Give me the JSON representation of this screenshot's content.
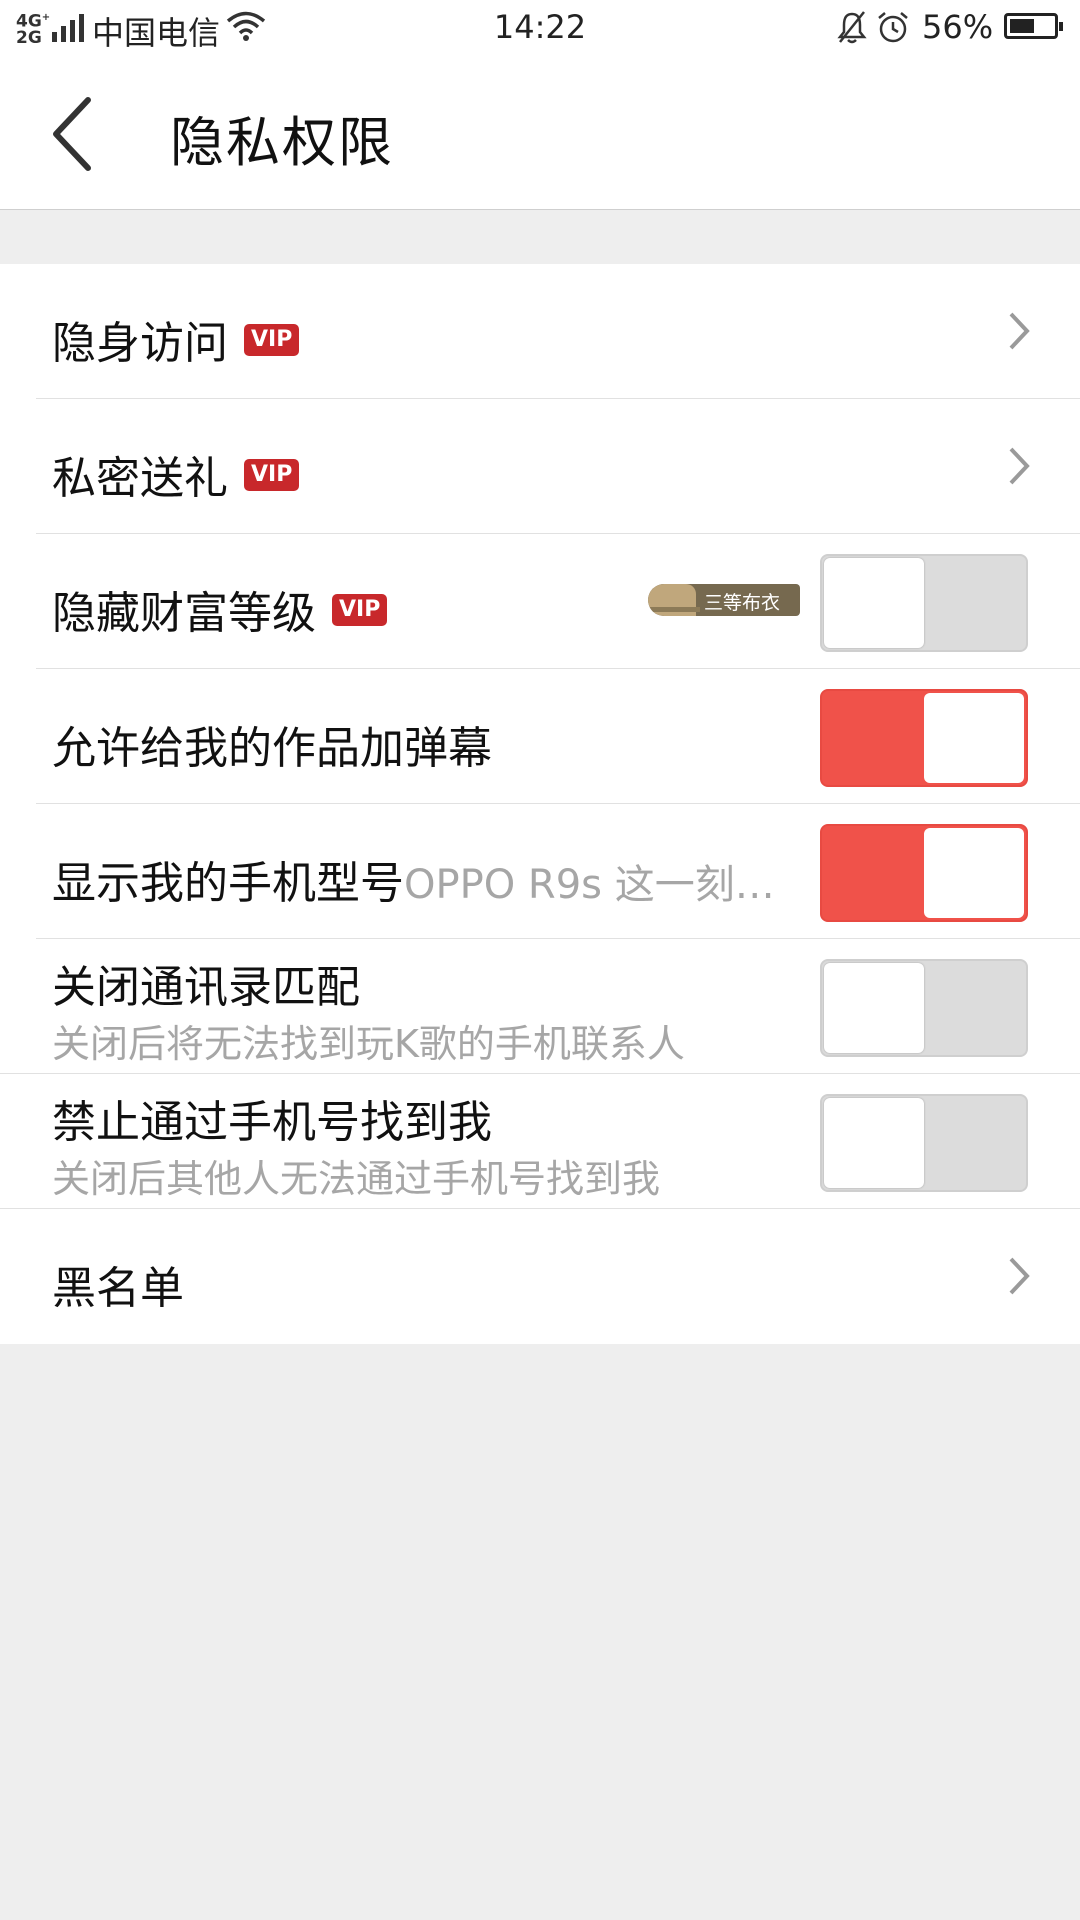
{
  "status_bar": {
    "network": "4G+ 2G",
    "carrier": "中国电信",
    "time": "14:22",
    "battery_percent": "56%",
    "battery_level": 0.56
  },
  "nav": {
    "title": "隐私权限",
    "back_icon": "chevron-left-icon"
  },
  "colors": {
    "accent": "#f0524a",
    "vip": "#c8282b",
    "toggle_off": "#dcdcdc"
  },
  "rows": [
    {
      "title": "隐身访问",
      "vip": "VIP",
      "control": "chevron"
    },
    {
      "title": "私密送礼",
      "vip": "VIP",
      "control": "chevron"
    },
    {
      "title": "隐藏财富等级",
      "vip": "VIP",
      "badge": "三等布衣",
      "control": "toggle",
      "on": false
    },
    {
      "title": "允许给我的作品加弹幕",
      "control": "toggle",
      "on": true
    },
    {
      "title": "显示我的手机型号",
      "extra": "OPPO R9s 这一刻…",
      "control": "toggle",
      "on": true
    },
    {
      "title": "关闭通讯录匹配",
      "subtitle": "关闭后将无法找到玩K歌的手机联系人",
      "control": "toggle",
      "on": false
    },
    {
      "title": "禁止通过手机号找到我",
      "subtitle": "关闭后其他人无法通过手机号找到我",
      "control": "toggle",
      "on": false
    },
    {
      "title": "黑名单",
      "control": "chevron"
    }
  ]
}
